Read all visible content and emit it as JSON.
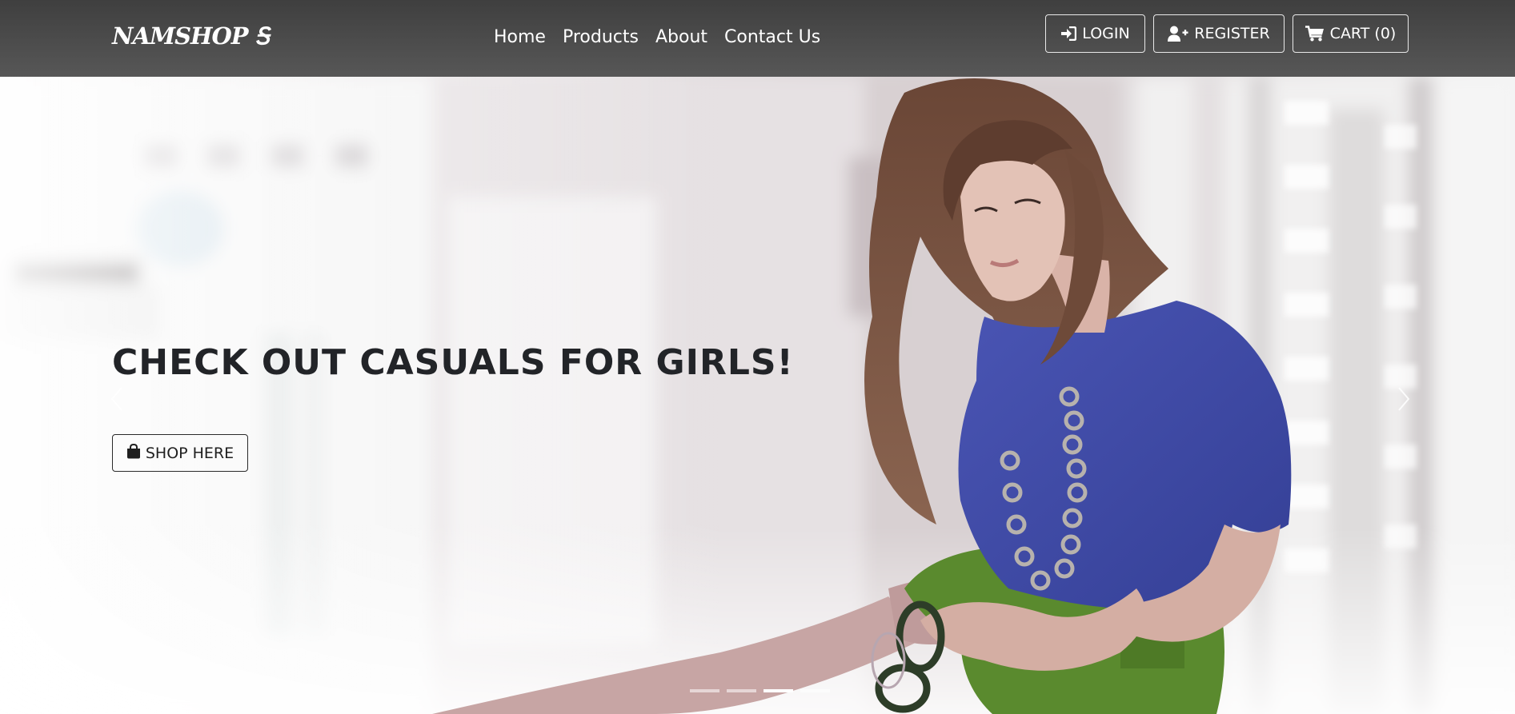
{
  "brand": {
    "name": "NAMSHOP",
    "logo_mark": "Ꭶ"
  },
  "nav": {
    "links": [
      "Home",
      "Products",
      "About",
      "Contact Us"
    ]
  },
  "auth": {
    "login_label": "LOGIN",
    "register_label": "REGISTER",
    "cart_label": "CART (0)"
  },
  "hero": {
    "heading": "CHECK OUT CASUALS FOR GIRLS!",
    "cta_label": "SHOP HERE",
    "slide_count": 4,
    "active_slide": 3
  },
  "icons": {
    "login": "sign-in-icon",
    "register": "user-plus-icon",
    "cart": "shopping-cart-icon",
    "shop": "shopping-bag-icon",
    "prev": "chevron-left-icon",
    "next": "chevron-right-icon"
  },
  "colors": {
    "navbar": "#4a4a4a",
    "nav_text": "#ffffff",
    "hero_heading": "#222428",
    "shirt": "#3f4aa8",
    "shorts": "#5a8a2e",
    "hair": "#5a3b2c"
  }
}
